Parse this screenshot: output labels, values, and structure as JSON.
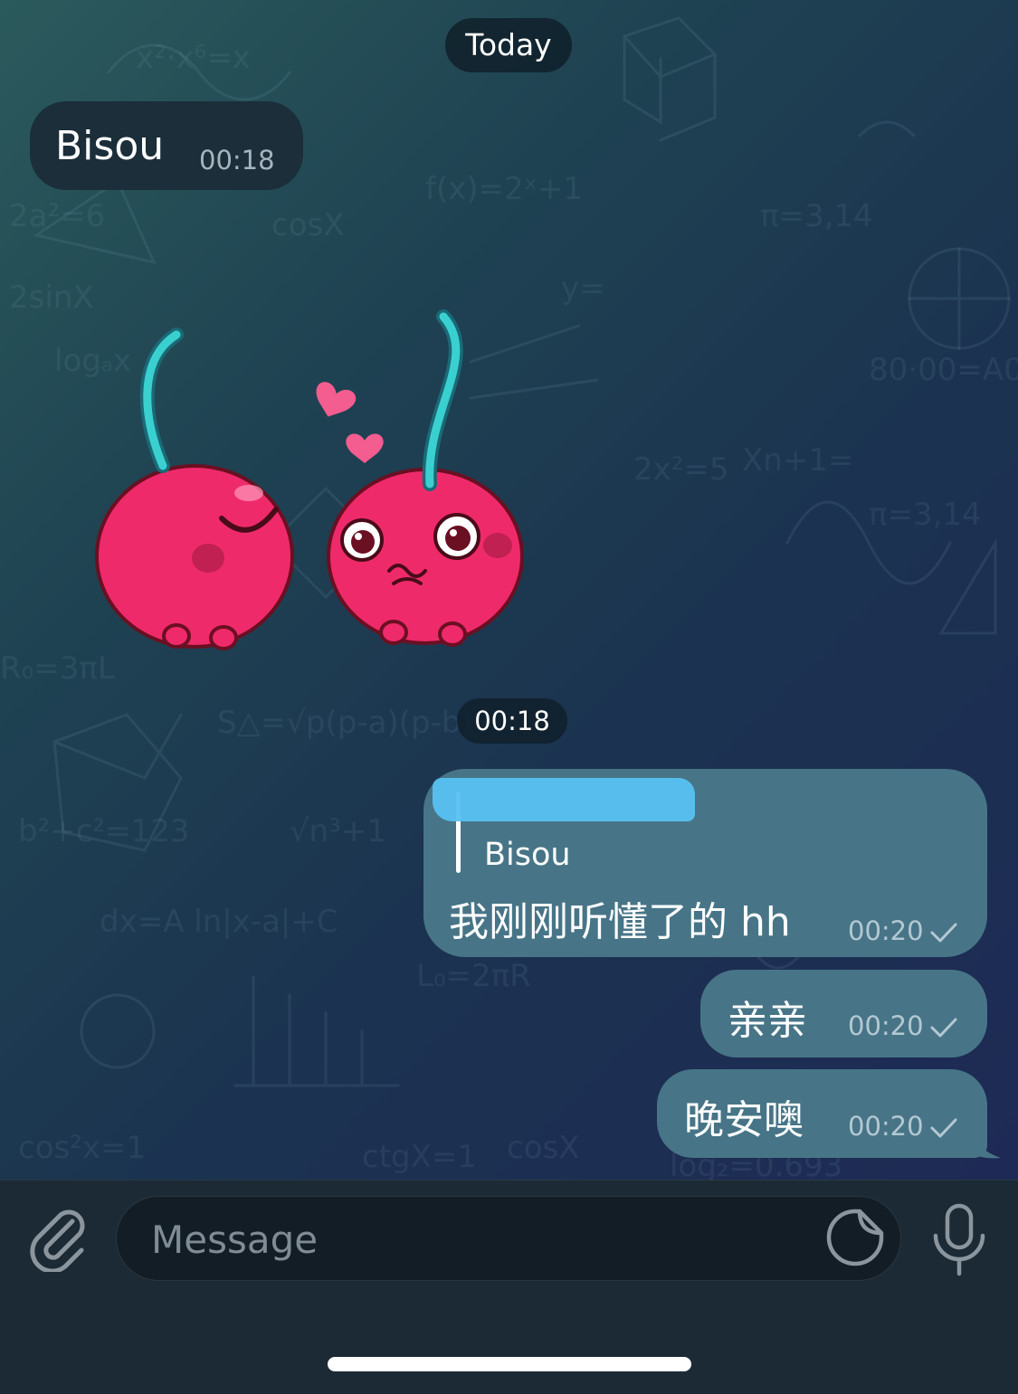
{
  "date_separator": "Today",
  "time_separator": "00:18",
  "messages": {
    "incoming_text": {
      "text": "Bisou",
      "time": "00:18"
    },
    "sticker": {
      "description_icon": "cherry-couple-sticker-icon"
    },
    "reply": {
      "quoted_sender": "Bisou",
      "text": "我刚刚听懂了的 hh",
      "time": "00:20"
    },
    "out1": {
      "text": "亲亲",
      "time": "00:20"
    },
    "out2": {
      "text": "晚安噢",
      "time": "00:20"
    }
  },
  "composer": {
    "placeholder": "Message",
    "attach_icon": "paperclip-icon",
    "sticker_icon": "sticker-icon",
    "mic_icon": "microphone-icon"
  },
  "colors": {
    "incoming_bubble": "#1b2e3a",
    "outgoing_bubble": "#477587",
    "input_bar": "#1c2a35",
    "heart": "#f35d8f",
    "cherry": "#ef2a6b",
    "stem": "#3ad0cf"
  }
}
